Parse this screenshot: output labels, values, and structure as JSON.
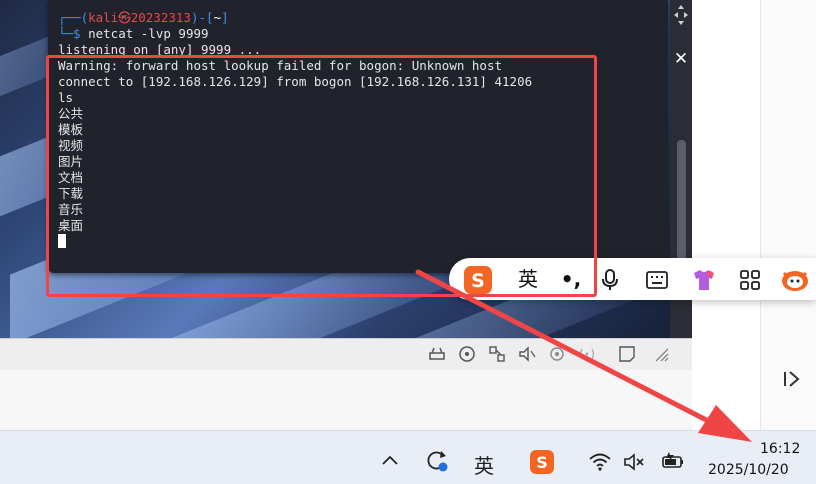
{
  "terminal": {
    "prompt_top": "┌──(kali㉿20232313)-[~]",
    "prompt_user": "kali",
    "prompt_host": "20232313",
    "prompt_dir": "~",
    "prompt_symbol": "└─$",
    "command": "netcat -lvp 9999",
    "listening": "listening on [any] 9999 ...",
    "lines": [
      "Warning: forward host lookup failed for bogon: Unknown host",
      "connect to [192.168.126.129] from bogon [192.168.126.131] 41206",
      "ls",
      "公共",
      "模板",
      "视频",
      "图片",
      "文档",
      "下载",
      "音乐",
      "桌面"
    ]
  },
  "ime_bar": {
    "logo": "S",
    "mode": "英",
    "punct": "•,",
    "icons": [
      "microphone-icon",
      "keyboard-icon",
      "skin-icon",
      "apps-grid-icon",
      "mascot-icon"
    ]
  },
  "taskbar": {
    "ime_mode": "英",
    "time": "16:12",
    "date": "2025/10/20",
    "icons": [
      "chevron-up-icon",
      "sync-icon",
      "ime-icon",
      "sogou-icon",
      "wifi-icon",
      "volume-muted-icon",
      "battery-icon"
    ]
  },
  "colors": {
    "terminal_bg": "#20232b",
    "prompt_blue": "#3f8ef0",
    "highlight_red": "#f04545",
    "sogou_orange": "#f26522"
  }
}
